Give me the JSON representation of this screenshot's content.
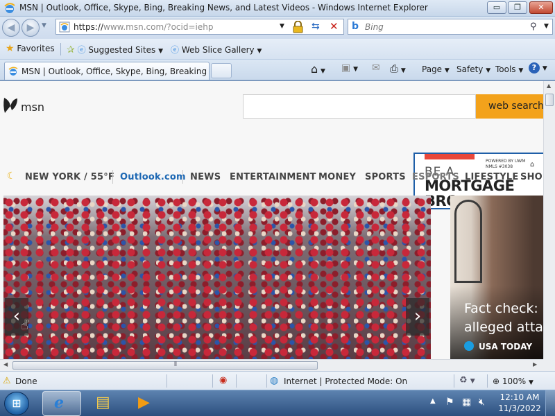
{
  "window": {
    "title": "MSN | Outlook, Office, Skype, Bing, Breaking News, and Latest Videos - Windows Internet Explorer",
    "minimize_glyph": "▭",
    "maximize_glyph": "❐",
    "close_glyph": "✕"
  },
  "address": {
    "url_scheme_host": "https://",
    "url_host": "www.msn.com",
    "url_path": "/?ocid=iehp"
  },
  "search": {
    "placeholder": "Bing"
  },
  "favorites_bar": {
    "favorites_label": "Favorites",
    "suggested_label": "Suggested Sites",
    "webslice_label": "Web Slice Gallery"
  },
  "tab": {
    "label": "MSN | Outlook, Office, Skype, Bing, Breaking Ne..."
  },
  "commands": {
    "page": "Page",
    "safety": "Safety",
    "tools": "Tools"
  },
  "msn": {
    "brand": "msn",
    "search_button": "web search",
    "nav": {
      "weather": "NEW YORK / 55°F",
      "outlook": "Outlook.com",
      "news": "NEWS",
      "entertainment": "ENTERTAINMENT",
      "money": "MONEY",
      "sports": "SPORTS",
      "esports": "ESPORTS",
      "lifestyle": "LIFESTYLE",
      "shop": "SHOP"
    },
    "ad": {
      "powered_by": "POWERED BY UWM",
      "nmls": "NMLS #3038",
      "line1": "BE A",
      "line2": "MORTGAGE",
      "line3": "BRO"
    },
    "card": {
      "headline_line1": "Fact check: P",
      "headline_line2": "alleged attac",
      "source": "USA TODAY"
    }
  },
  "status": {
    "text": "Done",
    "zone": "Internet | Protected Mode: On",
    "zoom": "100%"
  },
  "taskbar": {
    "time": "12:10 AM",
    "date": "11/3/2022"
  },
  "colors": {
    "msn_accent": "#f3a21b",
    "outlook_link": "#1c67b3",
    "ad_red": "#e8473a"
  }
}
